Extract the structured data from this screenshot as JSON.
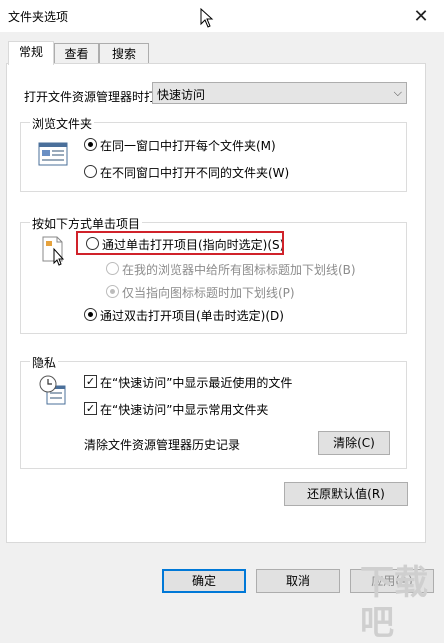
{
  "window": {
    "title": "文件夹选项"
  },
  "tabs": [
    {
      "label": "常规"
    },
    {
      "label": "查看"
    },
    {
      "label": "搜索"
    }
  ],
  "open_explorer": {
    "label": "打开文件资源管理器时打",
    "value": "快速访问"
  },
  "browse_folders": {
    "title": "浏览文件夹",
    "options": [
      "在同一窗口中打开每个文件夹(M)",
      "在不同窗口中打开不同的文件夹(W)"
    ]
  },
  "click_items": {
    "title": "按如下方式单击项目",
    "options": [
      "通过单击打开项目(指向时选定)(S)",
      "在我的浏览器中给所有图标标题加下划线(B)",
      "仅当指向图标标题时加下划线(P)",
      "通过双击打开项目(单击时选定)(D)"
    ]
  },
  "privacy": {
    "title": "隐私",
    "checks": [
      "在“快速访问”中显示最近使用的文件",
      "在“快速访问”中显示常用文件夹"
    ],
    "clear_label": "清除文件资源管理器历史记录",
    "clear_button": "清除(C)"
  },
  "restore_button": "还原默认值(R)",
  "footer": {
    "ok": "确定",
    "cancel": "取消",
    "apply": "应用(A)"
  },
  "watermark": "下载吧",
  "colors": {
    "highlight_box": "#d0222a",
    "accent": "#0078d7"
  }
}
